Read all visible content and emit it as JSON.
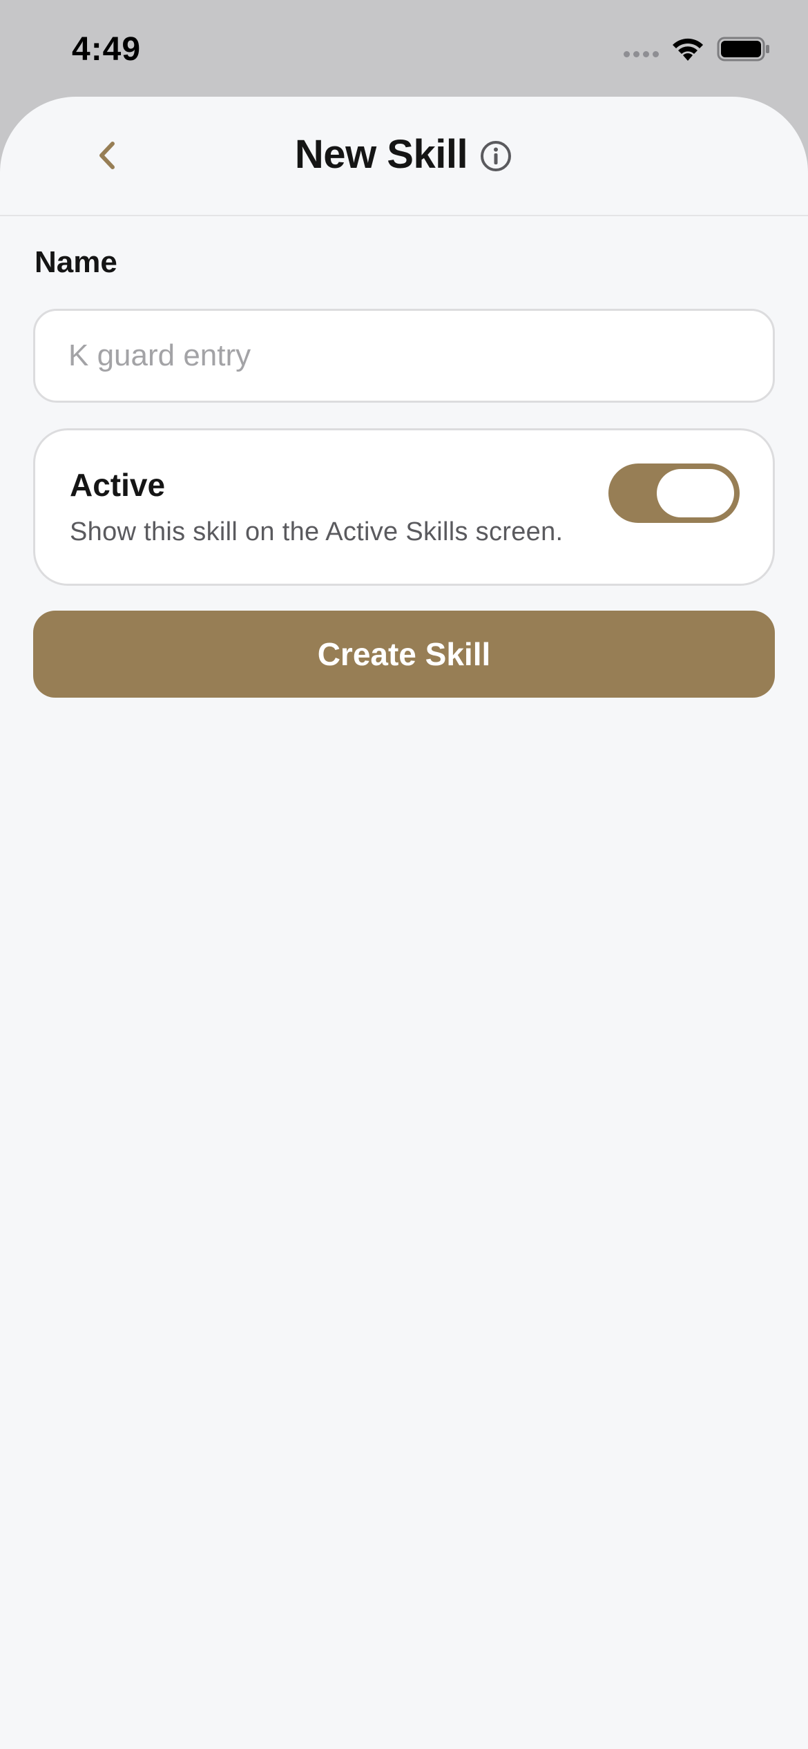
{
  "status_bar": {
    "time": "4:49",
    "icons": [
      "cellular-signal-icon",
      "wifi-icon",
      "battery-icon"
    ]
  },
  "header": {
    "title": "New Skill",
    "back_icon": "chevron-left-icon",
    "info_icon": "info-circle-icon"
  },
  "form": {
    "name_label": "Name",
    "name_input": {
      "value": "",
      "placeholder": "K guard entry"
    },
    "active": {
      "title": "Active",
      "description": "Show this skill on the Active Skills screen.",
      "enabled": true
    },
    "submit_label": "Create Skill"
  },
  "colors": {
    "accent": "#977e55",
    "background": "#f6f7f9",
    "status_bar_bg": "#c6c6c8",
    "text_primary": "#151515",
    "text_secondary": "#5a5a5e"
  }
}
